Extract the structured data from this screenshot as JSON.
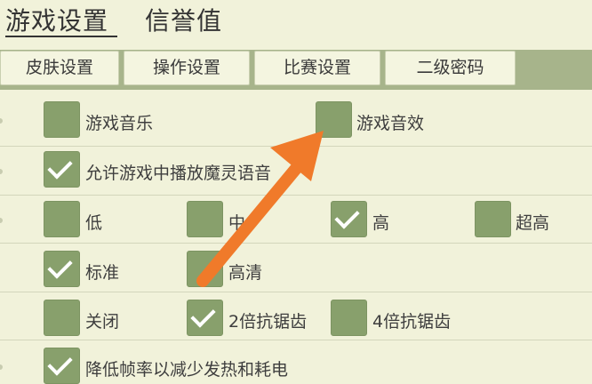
{
  "top_tabs": {
    "game_settings": "游戏设置",
    "credit": "信誉值"
  },
  "sub_tabs": [
    "皮肤设置",
    "操作设置",
    "比赛设置",
    "二级密码"
  ],
  "settings": {
    "music": {
      "label": "游戏音乐",
      "checked": false
    },
    "sfx": {
      "label": "游戏音效",
      "checked": false
    },
    "voice": {
      "label": "允许游戏中播放魔灵语音",
      "checked": true
    },
    "quality": [
      {
        "label": "低",
        "checked": false
      },
      {
        "label": "中",
        "checked": false
      },
      {
        "label": "高",
        "checked": true
      },
      {
        "label": "超高",
        "checked": false
      }
    ],
    "resolution": [
      {
        "label": "标准",
        "checked": true
      },
      {
        "label": "高清",
        "checked": false
      }
    ],
    "antialias": [
      {
        "label": "关闭",
        "checked": false
      },
      {
        "label": "2倍抗锯齿",
        "checked": true
      },
      {
        "label": "4倍抗锯齿",
        "checked": false
      }
    ],
    "low_fps": {
      "label": "降低帧率以减少发热和耗电",
      "checked": true
    }
  },
  "colors": {
    "checkbox": "#88a06c",
    "tab_bar": "#a7b48b",
    "background": "#f1f2da",
    "arrow": "#f07a2a"
  }
}
